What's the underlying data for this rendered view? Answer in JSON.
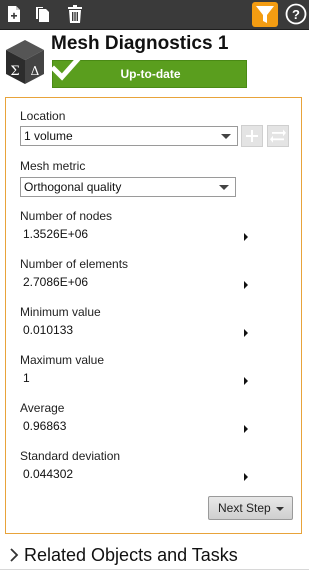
{
  "toolbar": {
    "icons": [
      "new-icon",
      "copy-icon",
      "delete-icon",
      "filter-icon",
      "help-icon"
    ],
    "filter_color": "#f39c12"
  },
  "header": {
    "title": "Mesh Diagnostics 1",
    "status": "Up-to-date",
    "status_color": "#5a9e1e"
  },
  "panel": {
    "border_color": "#e8a33a",
    "location": {
      "label": "Location",
      "value": "1 volume"
    },
    "metric": {
      "label": "Mesh metric",
      "value": "Orthogonal quality"
    },
    "stats": [
      {
        "label": "Number of nodes",
        "value": "1.3526E+06"
      },
      {
        "label": "Number of elements",
        "value": "2.7086E+06"
      },
      {
        "label": "Minimum value",
        "value": "0.010133"
      },
      {
        "label": "Maximum value",
        "value": "1"
      },
      {
        "label": "Average",
        "value": "0.96863"
      },
      {
        "label": "Standard deviation",
        "value": "0.044302"
      }
    ],
    "next_button": "Next Step"
  },
  "related": {
    "label": "Related Objects and Tasks"
  }
}
